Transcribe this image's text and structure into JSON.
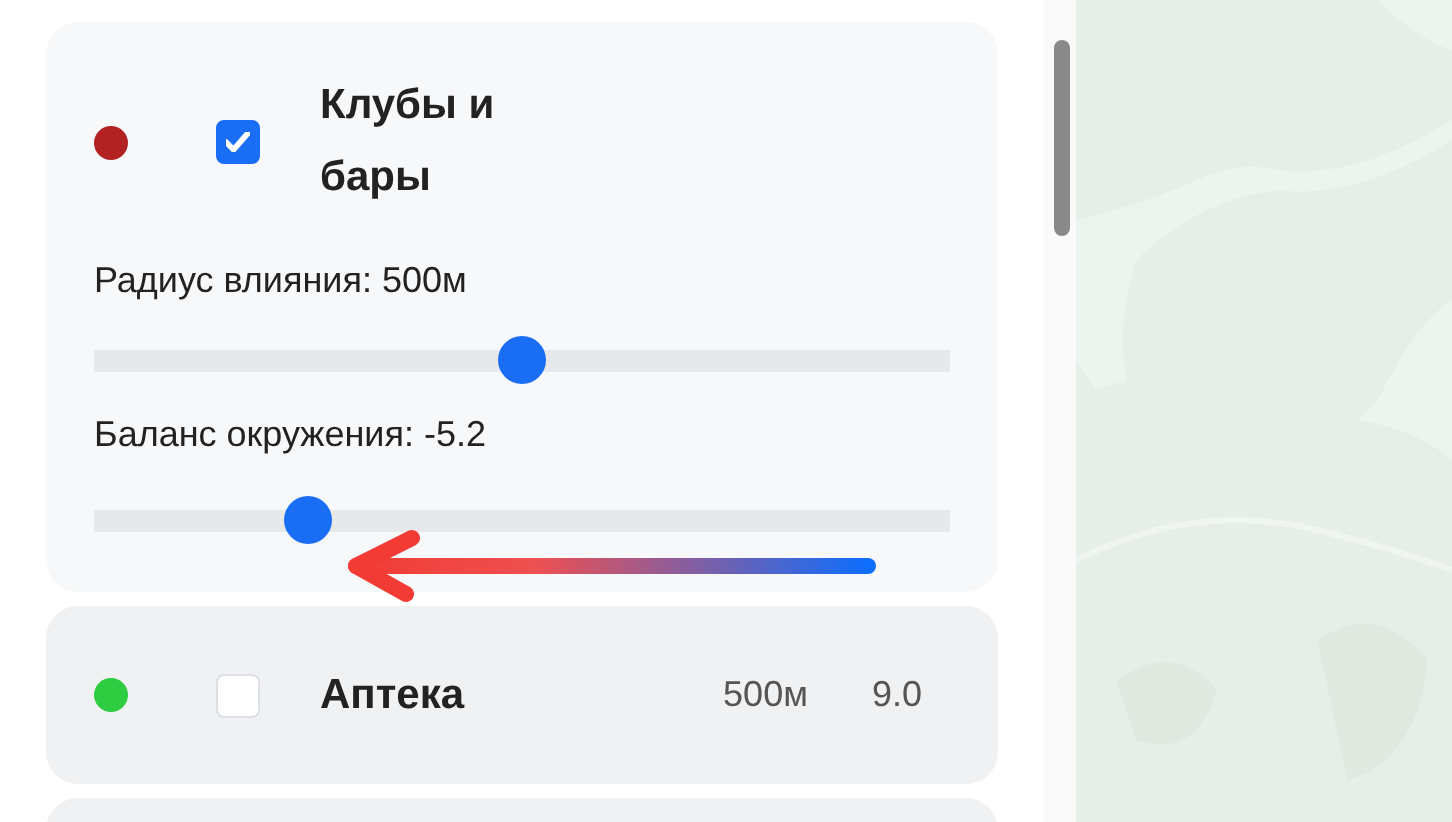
{
  "categories": [
    {
      "name": "Клубы и бары",
      "color": "#b22222",
      "checked": true,
      "expanded": true,
      "sliders": [
        {
          "label": "Радиус влияния: 500м",
          "level": 0.5
        },
        {
          "label": "Баланс окружения: -5.2",
          "level": 0.25
        }
      ]
    },
    {
      "name": "Аптека",
      "color": "#2ecc40",
      "checked": false,
      "expanded": false,
      "radius": "500м",
      "score": "9.0"
    }
  ]
}
